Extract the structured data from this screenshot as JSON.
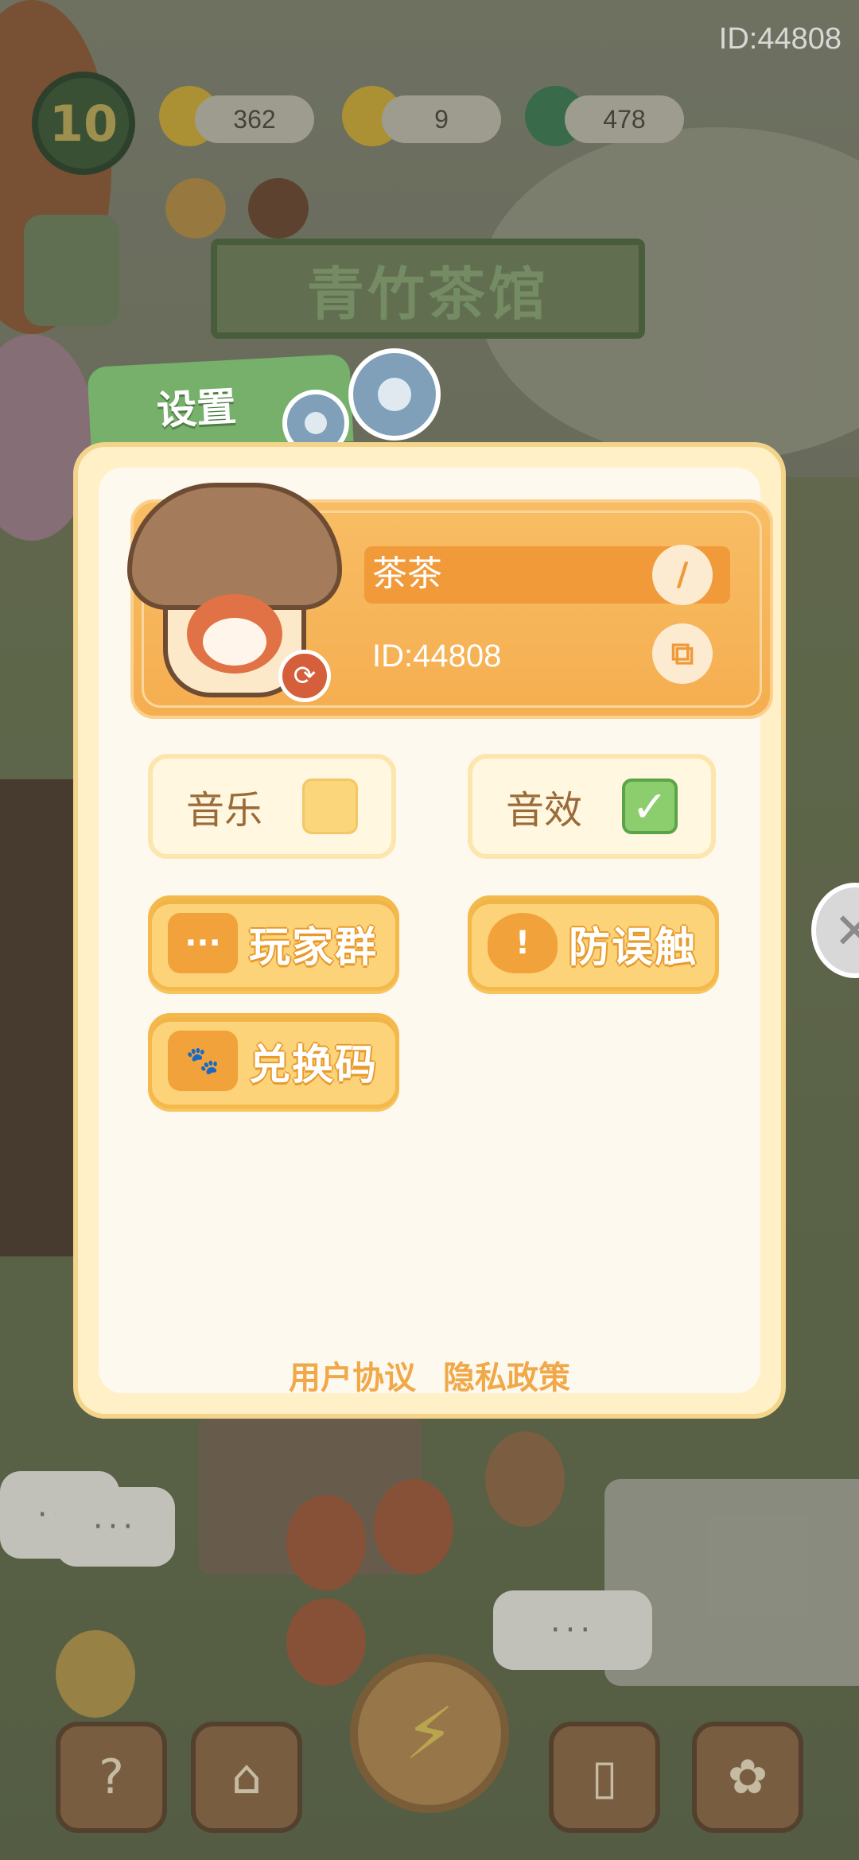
{
  "top_id": "ID:44808",
  "hud": {
    "level": "10",
    "energy": "362",
    "leaf": "9",
    "gem": "478"
  },
  "sign": "青竹茶馆",
  "settings": {
    "tab_title": "设置",
    "profile": {
      "name": "茶茶",
      "id": "ID:44808"
    },
    "toggles": {
      "music": {
        "label": "音乐",
        "checked": false
      },
      "sfx": {
        "label": "音效",
        "checked": true
      }
    },
    "buttons": {
      "player_group": "玩家群",
      "anti_mistouch": "防误触",
      "redeem_code": "兑换码"
    },
    "links": {
      "user_agreement": "用户协议",
      "privacy_policy": "隐私政策"
    }
  },
  "icons": {
    "check": "✓",
    "edit": "/",
    "copy": "⧉",
    "swap": "⟳",
    "close": "✕",
    "chat": "···",
    "warning": "!",
    "card": "🐾"
  },
  "colors": {
    "panel_bg": "#fdf9ee",
    "profile_orange": "#f5ae50",
    "tab_green": "#76b06a",
    "button_yellow": "#fdd37a",
    "check_green": "#8ccd6e"
  }
}
